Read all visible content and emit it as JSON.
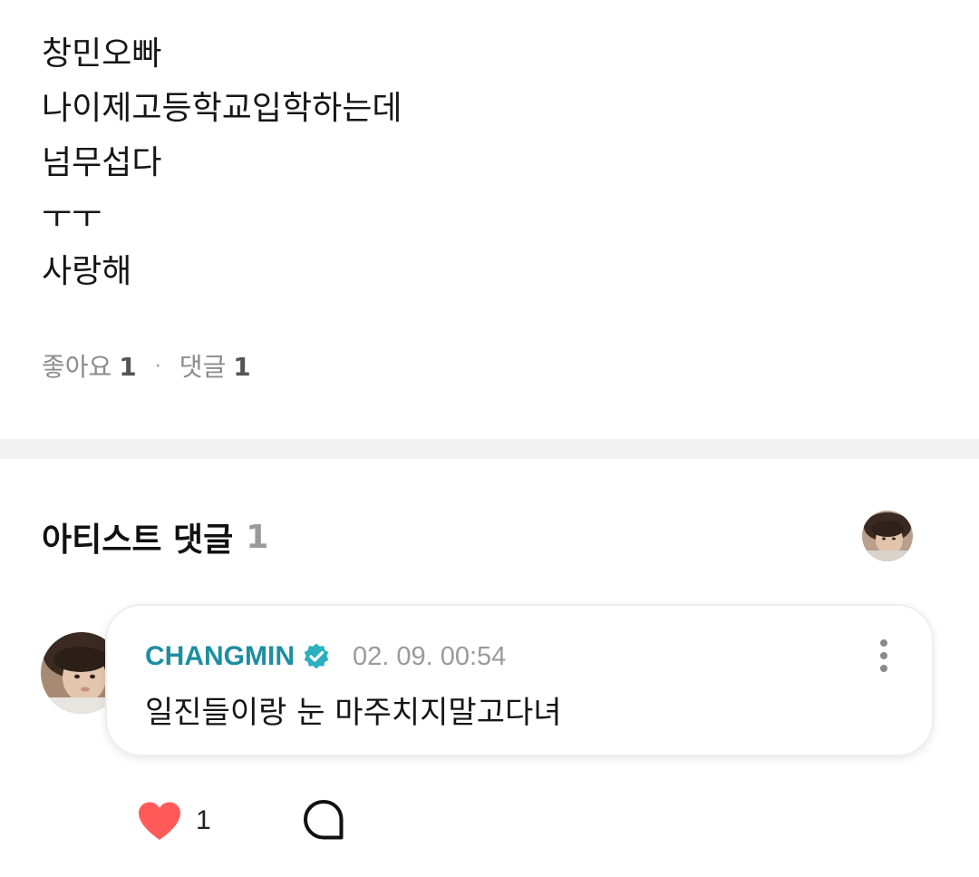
{
  "post": {
    "lines": [
      "창민오빠",
      "나이제고등학교입학하는데",
      "넘무섭다",
      "ㅜㅜ",
      "사랑해"
    ],
    "likes_label": "좋아요",
    "likes_count": "1",
    "separator": "·",
    "comments_label": "댓글",
    "comments_count": "1"
  },
  "artist_comments": {
    "title": "아티스트 댓글",
    "count": "1"
  },
  "comment": {
    "author": "CHANGMIN",
    "verified": true,
    "timestamp": "02. 09. 00:54",
    "text": "일진들이랑 눈 마주치지말고다녀",
    "like_count": "1"
  },
  "colors": {
    "accent": "#1e8ea1",
    "verified_badge": "#2bb0c0",
    "heart": "#ff5a57",
    "divider": "#f2f2f2"
  },
  "icons": {
    "verified": "verified-badge-icon",
    "more": "more-vertical-icon",
    "like": "heart-icon",
    "reply": "comment-bubble-icon"
  }
}
